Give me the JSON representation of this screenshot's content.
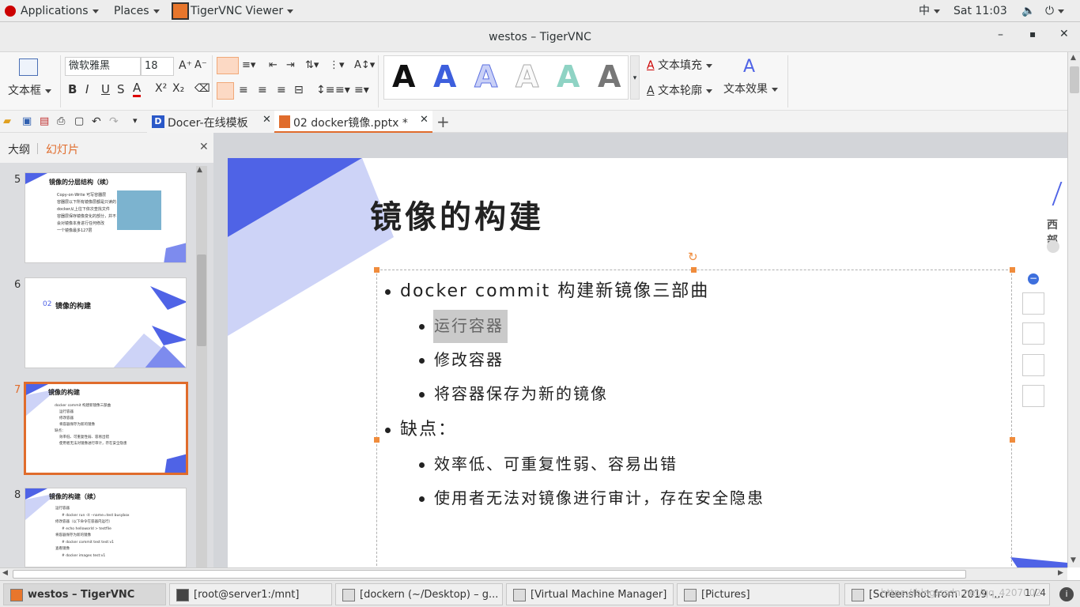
{
  "topbar": {
    "applications": "Applications",
    "places": "Places",
    "app": "TigerVNC Viewer",
    "ime": "中",
    "clock": "Sat 11:03"
  },
  "window": {
    "title": "westos – TigerVNC"
  },
  "ribbon": {
    "textbox_label": "文本框",
    "font_name": "微软雅黑",
    "font_size": "18",
    "text_fill": "文本填充",
    "text_outline": "文本轮廓",
    "text_effect": "文本效果",
    "gallery_letter": "A"
  },
  "tabs": [
    {
      "label": "Docer-在线模板"
    },
    {
      "label": "02 docker镜像.pptx *"
    }
  ],
  "leftpane": {
    "outline": "大纲",
    "slides": "幻灯片"
  },
  "thumbs": [
    {
      "num": "5",
      "title": "镜像的分层结构（续）",
      "lines": [
        "Copy-on-Write 可写容器层",
        "容器层以下所有镜像层都是只读的",
        "docker从上往下依次查找文件",
        "容器层保存镜像变化的部分，并不会对镜像本身进行任何修改",
        "一个镜像最多127层"
      ]
    },
    {
      "num": "6",
      "title": "镜像的构建",
      "prefix": "02"
    },
    {
      "num": "7",
      "title": "镜像的构建",
      "lines": [
        "docker commit 构建新镜像三部曲",
        "运行容器",
        "修改容器",
        "将容器保存为新的镜像",
        "缺点：",
        "效率低、可重复性弱、容易出错",
        "使用者无法对镜像进行审计，存在安全隐患"
      ]
    },
    {
      "num": "8",
      "title": "镜像的构建（续）",
      "lines": [
        "运行容器",
        "# docker run -it --name=test busybox",
        "修改容器（以下命令在容器内运行）",
        "# echo helloworld > testfile",
        "将容器保存为新的镜像",
        "# docker commit test test:v1",
        "查看镜像",
        "# docker images test:v1"
      ]
    }
  ],
  "slide": {
    "title": "镜像的构建",
    "right_brand": "西部",
    "bullets": [
      {
        "level": 1,
        "text": "docker commit 构建新镜像三部曲"
      },
      {
        "level": 2,
        "text": "运行容器"
      },
      {
        "level": 2,
        "text": "修改容器"
      },
      {
        "level": 2,
        "text": "将容器保存为新的镜像"
      },
      {
        "level": 1,
        "text": "缺点："
      },
      {
        "level": 2,
        "text": "效率低、可重复性弱、容易出错"
      },
      {
        "level": 2,
        "text": "使用者无法对镜像进行审计，存在安全隐患"
      }
    ]
  },
  "taskbar": [
    {
      "label": "westos – TigerVNC"
    },
    {
      "label": "[root@server1:/mnt]"
    },
    {
      "label": "[dockern (~/Desktop) – g..."
    },
    {
      "label": "[Virtual Machine Manager]"
    },
    {
      "label": "[Pictures]"
    },
    {
      "label": "[Screenshot from 2019 -..."
    }
  ],
  "taskbar_extra": {
    "watermark": "https://blog.csdn.net/qq_4207002",
    "pages": "1 / 4"
  },
  "colors": {
    "accent": "#4f63e6",
    "accent_light": "#cdd3f7",
    "orange": "#e06c2c",
    "handle": "#f08c3c"
  }
}
